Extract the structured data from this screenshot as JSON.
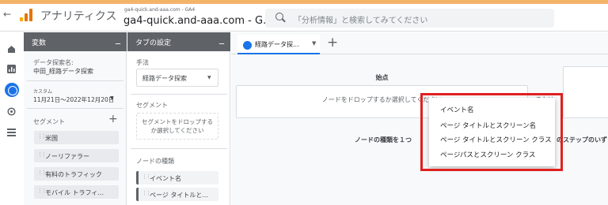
{
  "header": {
    "back_glyph": "←",
    "app_title": "アナリティクス",
    "account_small": "ga4-quick.and-aaa.com - GA4",
    "account_big": "ga4-quick.and-aaa.com - G...",
    "search_placeholder": "「分析情報」と検索してみてください",
    "logo_colors": [
      "#f9ab00",
      "#e37400",
      "#e37400"
    ]
  },
  "rail": {
    "icons": [
      "home-icon",
      "reports-icon",
      "explore-icon",
      "advertising-icon",
      "configure-icon"
    ]
  },
  "variables_panel": {
    "title": "変数",
    "minimize": "_",
    "exploration_name_label": "データ探索名:",
    "exploration_name": "中田_経路データ探索",
    "date_label": "カスタム",
    "date_range": "11月21日～2022年12月20日",
    "segments_label": "セグメント",
    "add_glyph": "+",
    "segments": [
      "米国",
      "ノーリファラー",
      "有料のトラフィック",
      "モバイル トラフィ..."
    ]
  },
  "settings_panel": {
    "title": "タブの設定",
    "minimize": "_",
    "technique_label": "手法",
    "technique_value": "経路データ探索",
    "segment_compare_label": "セグメント",
    "drop_hint_1": "セグメントをドロップする",
    "drop_hint_2": "か選択してください",
    "node_type_label": "ノードの種類",
    "node_types": [
      "イベント名",
      "ページ タイトルと..."
    ]
  },
  "canvas": {
    "tab_label": "経路データ探...",
    "add_tab": "+",
    "start_title": "始点",
    "card_text": "ノードをドロップするか選択してください",
    "peek_text": "または",
    "hint_left": "ノードの種類を１つ",
    "hint_right": "のステップのいず"
  },
  "menu": {
    "items": [
      "イベント名",
      "ページ タイトルとスクリーン名",
      "ページ タイトルとスクリーン クラス",
      "ページパスとスクリーン クラス"
    ]
  },
  "colors": {
    "accent": "#1a73e8",
    "highlight": "#e02020"
  }
}
